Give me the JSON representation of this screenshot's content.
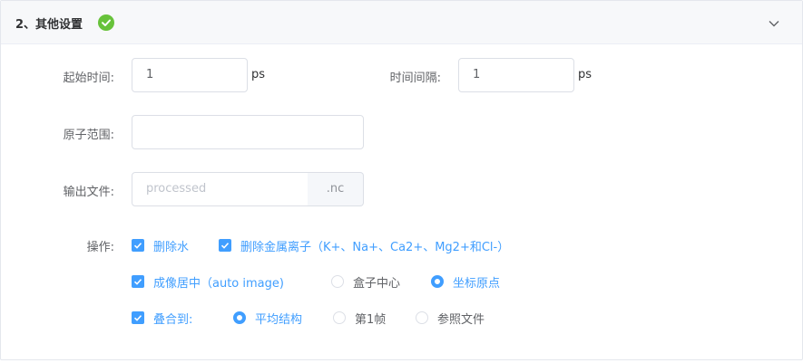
{
  "section": {
    "title": "2、其他设置",
    "status_icon": "check-circle-icon",
    "collapse_icon": "chevron-down-icon"
  },
  "form": {
    "start_time": {
      "label": "起始时间:",
      "value": "1",
      "unit": "ps"
    },
    "interval": {
      "label": "时间间隔:",
      "value": "1",
      "unit": "ps"
    },
    "atom_range": {
      "label": "原子范围:",
      "value": ""
    },
    "output_file": {
      "label": "输出文件:",
      "placeholder": "processed",
      "suffix": ".nc"
    },
    "operations": {
      "label": "操作:",
      "remove_water": {
        "label": "删除水",
        "checked": true
      },
      "remove_ions": {
        "label": "删除金属离子（K+、Na+、Ca2+、Mg2+和Cl-）",
        "checked": true
      },
      "image_center": {
        "label": "成像居中（auto image)",
        "checked": true
      },
      "center_box": {
        "label": "盒子中心",
        "selected": false
      },
      "center_origin": {
        "label": "坐标原点",
        "selected": true
      },
      "superpose": {
        "label": "叠合到:",
        "checked": true
      },
      "ref_average": {
        "label": "平均结构",
        "selected": true
      },
      "ref_frame1": {
        "label": "第1帧",
        "selected": false
      },
      "ref_file": {
        "label": "参照文件",
        "selected": false
      }
    }
  },
  "colors": {
    "accent": "#409eff",
    "success": "#67c23a"
  }
}
